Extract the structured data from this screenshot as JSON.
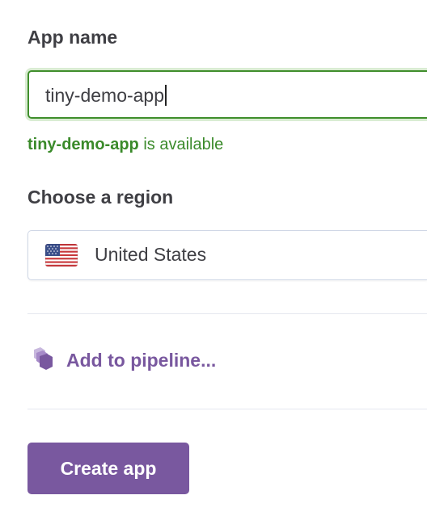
{
  "form": {
    "app_name_label": "App name",
    "app_name_value": "tiny-demo-app",
    "availability": {
      "app_slug": "tiny-demo-app",
      "message": " is available",
      "color": "#3a8a2a"
    },
    "region_label": "Choose a region",
    "region": {
      "selected": "United States",
      "flag_icon": "us-flag-icon"
    },
    "pipeline": {
      "label": "Add to pipeline...",
      "icon": "pipeline-hexagon-icon"
    },
    "submit_label": "Create app"
  },
  "colors": {
    "accent": "#79589f",
    "success": "#3f8e2c",
    "text": "#3f3f44",
    "border": "#cfd7e6"
  }
}
